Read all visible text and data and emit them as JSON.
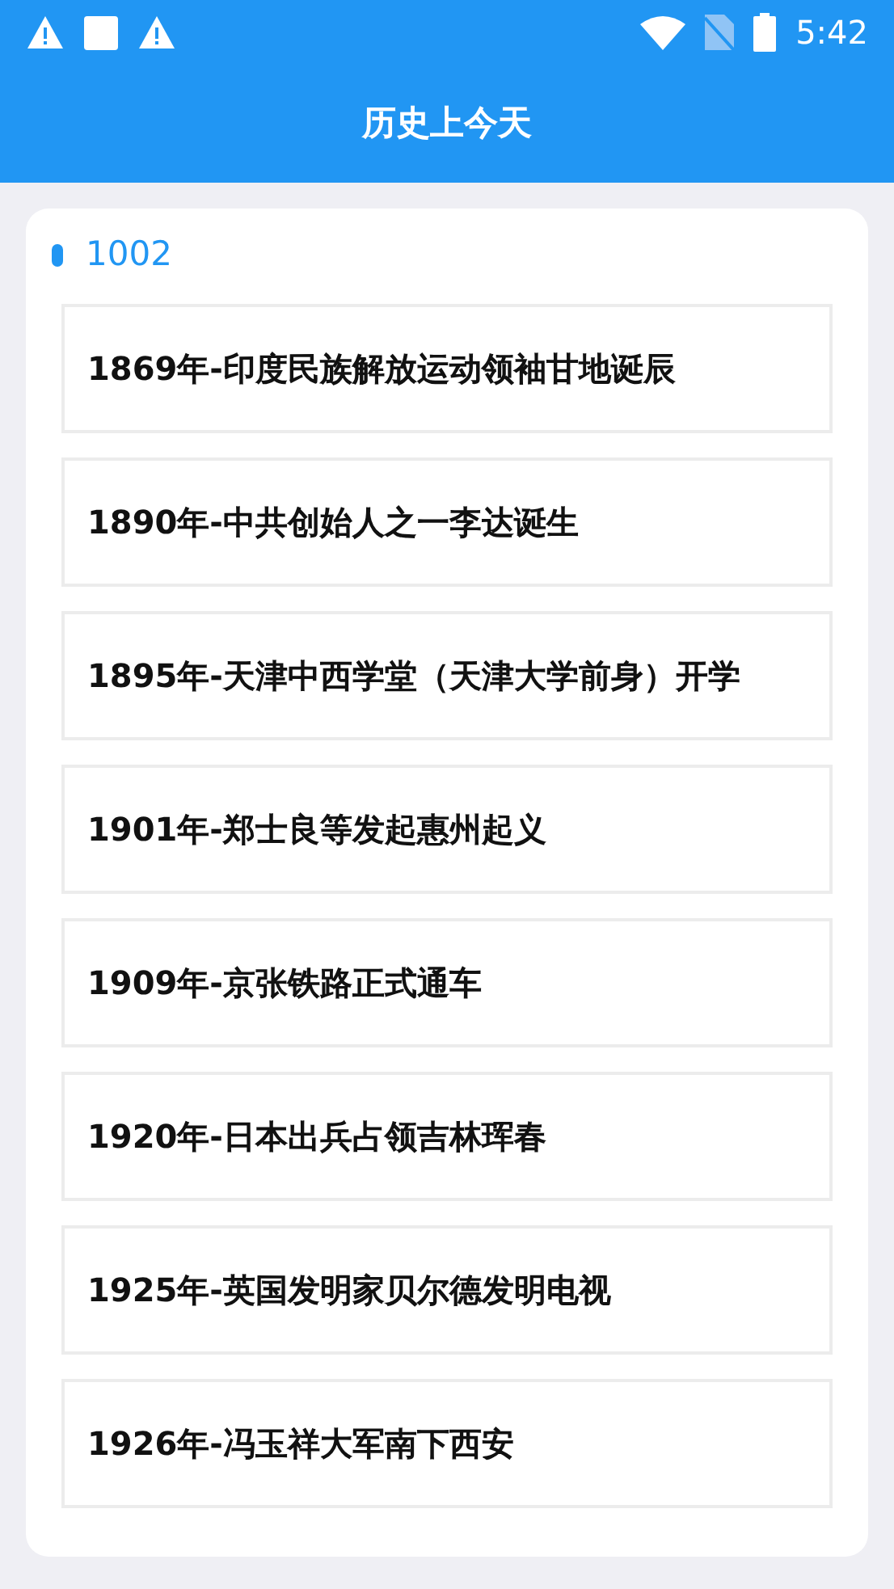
{
  "status_bar": {
    "time": "5:42"
  },
  "header": {
    "title": "历史上今天"
  },
  "section": {
    "date": "1002",
    "events": [
      "1869年-印度民族解放运动领袖甘地诞辰",
      "1890年-中共创始人之一李达诞生",
      "1895年-天津中西学堂（天津大学前身）开学",
      "1901年-郑士良等发起惠州起义",
      "1909年-京张铁路正式通车",
      "1920年-日本出兵占领吉林珲春",
      "1925年-英国发明家贝尔德发明电视",
      "1926年-冯玉祥大军南下西安"
    ]
  }
}
